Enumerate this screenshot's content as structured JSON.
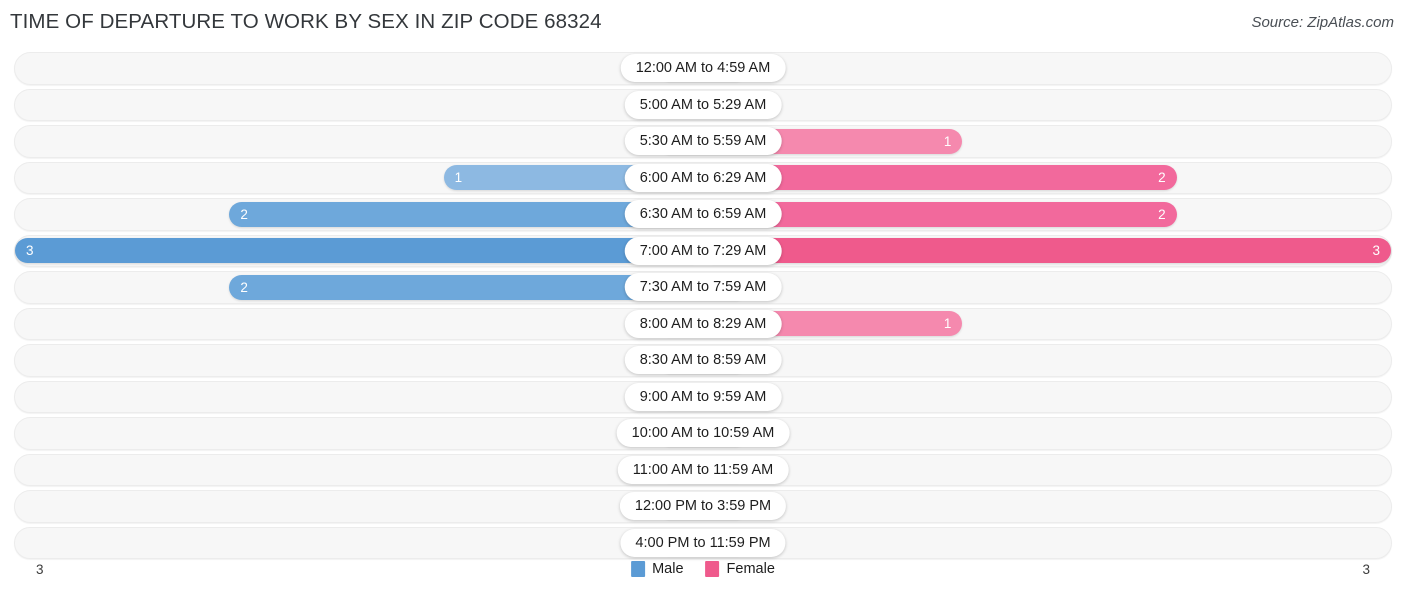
{
  "header": {
    "title": "TIME OF DEPARTURE TO WORK BY SEX IN ZIP CODE 68324",
    "source": "Source: ZipAtlas.com"
  },
  "legend": {
    "male_label": "Male",
    "female_label": "Female",
    "male_color": "#5b9bd5",
    "female_color": "#ef5a8c"
  },
  "axis": {
    "left_max": "3",
    "right_max": "3"
  },
  "chart_data": {
    "type": "bar",
    "title": "TIME OF DEPARTURE TO WORK BY SEX IN ZIP CODE 68324",
    "subtitle": "",
    "xlabel": "",
    "ylabel": "",
    "orientation": "horizontal-diverging",
    "grid": false,
    "legend_position": "bottom-center",
    "xlim": [
      3,
      3
    ],
    "axis_max": 3,
    "categories": [
      "12:00 AM to 4:59 AM",
      "5:00 AM to 5:29 AM",
      "5:30 AM to 5:59 AM",
      "6:00 AM to 6:29 AM",
      "6:30 AM to 6:59 AM",
      "7:00 AM to 7:29 AM",
      "7:30 AM to 7:59 AM",
      "8:00 AM to 8:29 AM",
      "8:30 AM to 8:59 AM",
      "9:00 AM to 9:59 AM",
      "10:00 AM to 10:59 AM",
      "11:00 AM to 11:59 AM",
      "12:00 PM to 3:59 PM",
      "4:00 PM to 11:59 PM"
    ],
    "series": [
      {
        "name": "Male",
        "color": "#5b9bd5",
        "values": [
          0,
          0,
          0,
          1,
          2,
          3,
          2,
          0,
          0,
          0,
          0,
          0,
          0,
          0
        ]
      },
      {
        "name": "Female",
        "color": "#ef5a8c",
        "values": [
          0,
          0,
          1,
          2,
          2,
          3,
          0,
          1,
          0,
          0,
          0,
          0,
          0,
          0
        ]
      }
    ]
  }
}
